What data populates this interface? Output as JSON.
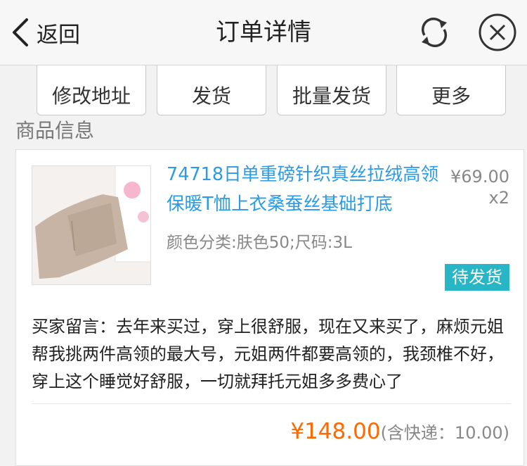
{
  "header": {
    "back_label": "返回",
    "title": "订单详情",
    "icons": [
      "chevron-left-icon",
      "refresh-icon",
      "close-icon"
    ]
  },
  "actions": [
    "修改地址",
    "发货",
    "批量发货",
    "更多"
  ],
  "section": {
    "label": "商品信息"
  },
  "product": {
    "title": "74718日单重磅针织真丝拉绒高领保暖T恤上衣桑蚕丝基础打底",
    "price": "¥69.00",
    "qty": "x2",
    "sku": "颜色分类:肤色50;尺码:3L",
    "status": "待发货"
  },
  "message": "买家留言：去年来买过，穿上很舒服，现在又来买了，麻烦元姐帮我挑两件高领的最大号，元姐两件都要高领的，我颈椎不好，穿上这个睡觉好舒服，一切就拜托元姐多多费心了",
  "total": {
    "amount": "¥148.00",
    "shipping": "(含快递：10.00)"
  },
  "colors": {
    "link": "#2b9be6",
    "status_bg": "#28b6c6",
    "price_accent": "#ff6a00"
  }
}
